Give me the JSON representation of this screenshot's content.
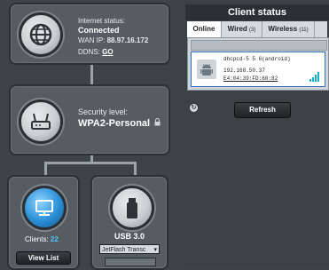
{
  "internet": {
    "status_label": "Internet status:",
    "status_value": "Connected",
    "wan_ip_label": "WAN IP:",
    "wan_ip": "88.97.16.172",
    "ddns_label": "DDNS:",
    "ddns_link": "GO"
  },
  "security": {
    "label": "Security level:",
    "value": "WPA2-Personal"
  },
  "clients": {
    "label": "Clients:",
    "count": "22",
    "button": "View List"
  },
  "usb": {
    "title": "USB 3.0",
    "device_selected": "JetFlash Transc"
  },
  "client_status": {
    "title": "Client status",
    "tabs": [
      {
        "label": "Online",
        "count": ""
      },
      {
        "label": "Wired",
        "count": "(3)"
      },
      {
        "label": "Wireless",
        "count": "(11)"
      }
    ],
    "device": {
      "name": "dhcpcd-5 5 6(android)",
      "ip": "192.168.50.37",
      "mac": "E4:04:39:FD:60:82"
    },
    "refresh_button": "Refresh"
  },
  "colors": {
    "accent_blue": "#2a8fd6",
    "clients_count": "#4fc3f7",
    "wifi_signal": "#19b3c9"
  }
}
